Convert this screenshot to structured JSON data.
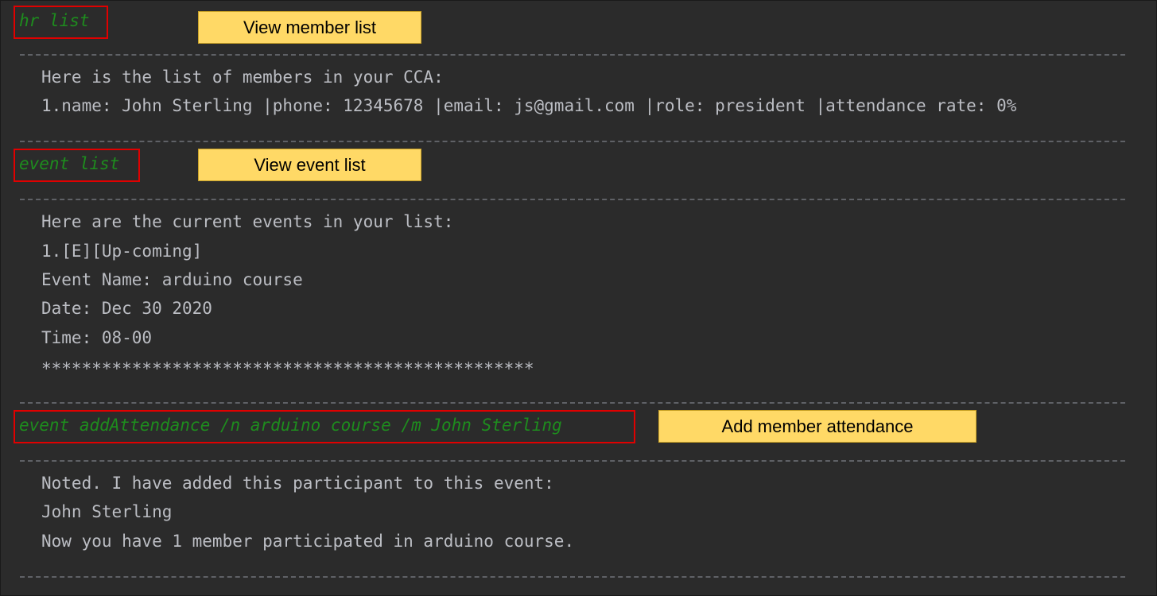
{
  "block1": {
    "command": "hr list",
    "callout": "View member list",
    "output": [
      "Here is the list of members in your CCA:",
      "1.name: John Sterling |phone: 12345678 |email: js@gmail.com |role: president |attendance rate: 0%"
    ]
  },
  "block2": {
    "command": "event list",
    "callout": "View event list",
    "output": [
      "Here are the current events in your list:",
      "1.[E][Up-coming]",
      "Event Name: arduino course",
      "Date: Dec 30 2020",
      "Time: 08-00",
      "*************************************************"
    ]
  },
  "block3": {
    "command": "event addAttendance /n arduino course /m John Sterling",
    "callout": "Add member attendance",
    "output": [
      "Noted. I have added this participant to this event:",
      "John Sterling",
      "Now you have 1 member participated in arduino course."
    ]
  },
  "colors": {
    "background": "#2b2b2b",
    "output_text": "#bcbec4",
    "command_text": "#1e8c1e",
    "command_box_border": "#e00000",
    "callout_fill": "#ffd966"
  }
}
